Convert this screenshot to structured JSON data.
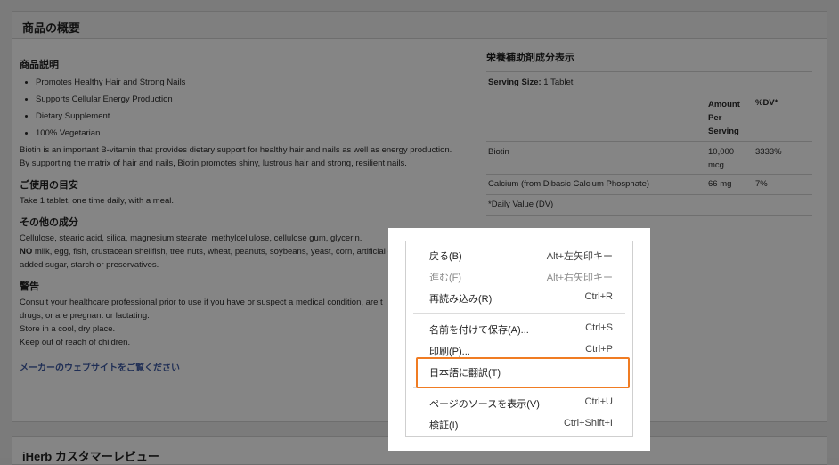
{
  "product_overview": {
    "title": "商品の概要",
    "description_heading": "商品説明",
    "bullets": [
      "Promotes Healthy Hair and Strong Nails",
      "Supports Cellular Energy Production",
      "Dietary Supplement",
      "100% Vegetarian"
    ],
    "description_text": "Biotin is an important B-vitamin that provides dietary support for healthy hair and nails as well as energy production. By supporting the matrix of hair and nails, Biotin promotes shiny, lustrous hair and strong, resilient nails.",
    "usage_heading": "ご使用の目安",
    "usage_text": "Take 1 tablet, one time daily, with a meal.",
    "other_heading": "その他の成分",
    "other_text_1": "Cellulose, stearic acid, silica, magnesium stearate, methylcellulose, cellulose gum, glycerin.",
    "other_no": "NO",
    "other_text_2": " milk, egg, fish, crustacean shellfish, tree nuts, wheat, peanuts, soybeans, yeast, corn, artificial c",
    "other_text_3": "added sugar, starch or preservatives.",
    "warning_heading": "警告",
    "warning_lines": [
      "Consult your healthcare professional prior to use if you have or suspect a medical condition, are t",
      "drugs, or are pregnant or lactating.",
      "Store in a cool, dry place.",
      "Keep out of reach of children."
    ],
    "maker_link": "メーカーのウェブサイトをご覧ください"
  },
  "nutrition": {
    "title": "栄養補助剤成分表示",
    "serving_label": "Serving Size:",
    "serving_value": " 1 Tablet",
    "col_amount_lines": [
      "Amount",
      "Per",
      "Serving"
    ],
    "col_dv": "%DV*",
    "rows": [
      {
        "name": "Biotin",
        "amount_lines": [
          "10,000",
          "mcg"
        ],
        "dv": "3333%"
      },
      {
        "name": "Calcium (from Dibasic Calcium Phosphate)",
        "amount_lines": [
          "66 mg"
        ],
        "dv": "7%"
      }
    ],
    "footnote": "*Daily Value (DV)"
  },
  "reviews": {
    "title": "iHerb カスタマーレビュー"
  },
  "context_menu": {
    "items": [
      {
        "label": "戻る(B)",
        "shortcut": "Alt+左矢印キー",
        "enabled": true
      },
      {
        "label": "進む(F)",
        "shortcut": "Alt+右矢印キー",
        "enabled": false
      },
      {
        "label": "再読み込み(R)",
        "shortcut": "Ctrl+R",
        "enabled": true
      },
      {
        "label": "名前を付けて保存(A)...",
        "shortcut": "Ctrl+S",
        "enabled": true
      },
      {
        "label": "印刷(P)...",
        "shortcut": "Ctrl+P",
        "enabled": true
      },
      {
        "label": "日本語に翻訳(T)",
        "shortcut": "",
        "enabled": true,
        "highlighted": true
      },
      {
        "label": "ページのソースを表示(V)",
        "shortcut": "Ctrl+U",
        "enabled": true
      },
      {
        "label": "検証(I)",
        "shortcut": "Ctrl+Shift+I",
        "enabled": true
      }
    ],
    "highlight_color": "#f07c23"
  }
}
